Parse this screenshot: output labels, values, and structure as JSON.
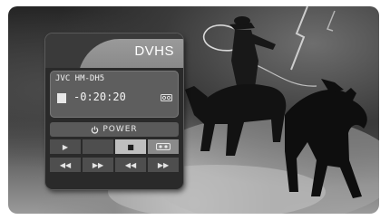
{
  "panel": {
    "title": "DVHS",
    "device_label": "JVC HM-DH5",
    "time_counter": "-0:20:20",
    "power_label": "POWER"
  },
  "icons": {
    "stop_indicator": "stop-square",
    "cassette": "cassette-tape",
    "power": "power-symbol",
    "play": "play-triangle",
    "pause": "pause-bars",
    "stop": "stop-square",
    "record": "record-tape",
    "rewind": "rewind-arrows",
    "fast_forward": "fast-forward-arrows",
    "skip_back": "skip-back",
    "skip_forward": "skip-forward"
  },
  "colors": {
    "panel_bg": "#2a2a2a",
    "header_swoosh": "#8a8a8a",
    "status_box": "#5e5e5e",
    "text": "#f0f0f0"
  }
}
